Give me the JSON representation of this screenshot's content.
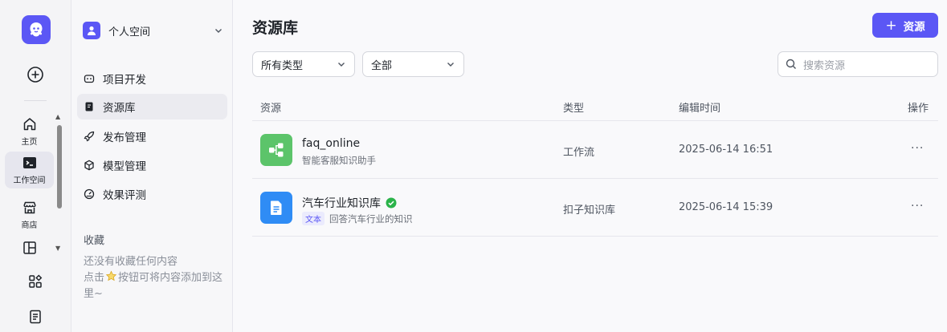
{
  "colors": {
    "accent": "#5b57f5",
    "workflow_green": "#5cc46a",
    "kb_blue": "#2f8cf5",
    "verified": "#2bb34a"
  },
  "rail": {
    "logo_icon": "ghost-logo-icon",
    "items": [
      {
        "label": "主页",
        "icon": "home-icon"
      },
      {
        "label": "工作空间",
        "icon": "terminal-icon"
      },
      {
        "label": "商店",
        "icon": "store-icon"
      }
    ]
  },
  "sidebar": {
    "space_name": "个人空间",
    "menu": [
      {
        "label": "项目开发",
        "icon": "robot-icon"
      },
      {
        "label": "资源库",
        "icon": "book-icon"
      },
      {
        "label": "发布管理",
        "icon": "rocket-icon"
      },
      {
        "label": "模型管理",
        "icon": "cube-icon"
      },
      {
        "label": "效果评测",
        "icon": "gauge-icon"
      }
    ],
    "favorites_title": "收藏",
    "favorites_empty_line1": "还没有收藏任何内容",
    "favorites_empty_line2a": "点击",
    "favorites_empty_line2b": "按钮可将内容添加到这里~"
  },
  "main": {
    "title": "资源库",
    "add_button": "资源",
    "filter_type": "所有类型",
    "filter_scope": "全部",
    "search_placeholder": "搜索资源",
    "columns": {
      "resource": "资源",
      "type": "类型",
      "edited": "编辑时间",
      "actions": "操作"
    },
    "rows": [
      {
        "name": "faq_online",
        "desc": "智能客服知识助手",
        "type": "工作流",
        "edited": "2025-06-14 16:51",
        "more": "···"
      },
      {
        "name": "汽车行业知识库",
        "tag": "文本",
        "desc": "回答汽车行业的知识",
        "type": "扣子知识库",
        "edited": "2025-06-14 15:39",
        "more": "···"
      }
    ]
  }
}
